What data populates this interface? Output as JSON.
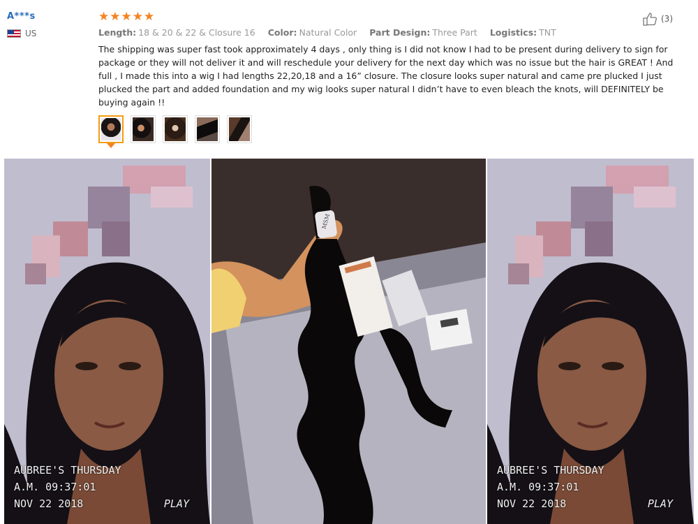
{
  "reviewer": {
    "name": "A***s",
    "country": "US"
  },
  "rating": {
    "stars": 5,
    "max": 5
  },
  "meta": {
    "length_label": "Length:",
    "length_value": "18 & 20 & 22 & Closure 16",
    "color_label": "Color:",
    "color_value": "Natural Color",
    "part_label": "Part Design:",
    "part_value": "Three Part",
    "logistics_label": "Logistics:",
    "logistics_value": "TNT"
  },
  "review_text": "The shipping was super fast took approximately 4 days , only thing is I did not know I had to be present during delivery to sign for package or they will not deliver it and will reschedule your delivery for the next day which was no issue but the hair is GREAT ! And full , I made this into a wig I had lengths 22,20,18 and a 16” closure. The closure looks super natural and came pre plucked I just plucked the part and added foundation and my wig looks super natural I didn’t have to even bleach the knots, will DEFINITELY be buying again !!",
  "helpful": {
    "count": "(3)",
    "icon": "thumbs-up-icon"
  },
  "thumbnails": {
    "count": 5,
    "selected": 0
  },
  "photos": {
    "left": {
      "line1": "AUBREE'S THURSDAY",
      "line2": "A.M. 09:37:01",
      "line3": "NOV 22 2018",
      "play": "PLAY"
    },
    "right": {
      "line1": "AUBREE'S THURSDAY",
      "line2": "A.M. 09:37:01",
      "line3": "NOV 22 2018",
      "play": "PLAY"
    },
    "label_text": "MSM"
  },
  "colors": {
    "star": "#f58220",
    "reviewer": "#2a6ebb",
    "thumb_active_border": "#f39c12"
  }
}
